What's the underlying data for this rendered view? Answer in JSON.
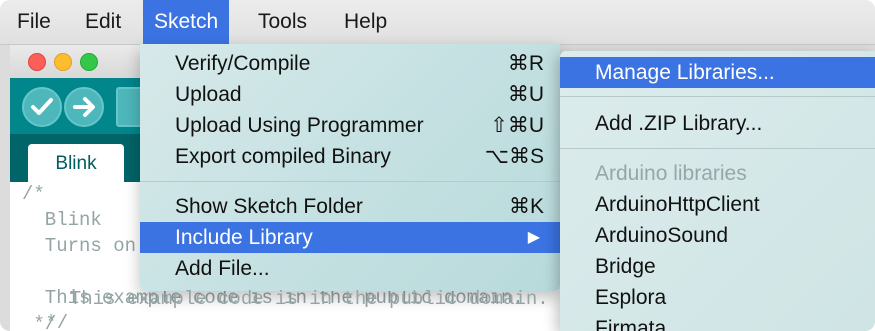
{
  "menubar": {
    "items": [
      "File",
      "Edit",
      "Sketch",
      "Tools",
      "Help"
    ],
    "active": "Sketch"
  },
  "window": {
    "tab_label": "Blink",
    "code_lines": [
      "/*",
      "  Blink",
      "  Turns on",
      "",
      "  This example code is in the public domain.",
      " */"
    ]
  },
  "sketch_menu": {
    "items": [
      {
        "label": "Verify/Compile",
        "shortcut": "⌘R"
      },
      {
        "label": "Upload",
        "shortcut": "⌘U"
      },
      {
        "label": "Upload Using Programmer",
        "shortcut": "⇧⌘U"
      },
      {
        "label": "Export compiled Binary",
        "shortcut": "⌥⌘S"
      },
      {
        "label": "Show Sketch Folder",
        "shortcut": "⌘K"
      },
      {
        "label": "Include Library",
        "shortcut": "▶"
      },
      {
        "label": "Add File...",
        "shortcut": ""
      }
    ]
  },
  "library_menu": {
    "manage": "Manage Libraries...",
    "add_zip": "Add .ZIP Library...",
    "section_header": "Arduino libraries",
    "libraries": [
      "ArduinoHttpClient",
      "ArduinoSound",
      "Bridge",
      "Esplora",
      "Firmata"
    ]
  },
  "colors": {
    "accent": "#3b73e3",
    "toolbar": "#00868b",
    "tabstrip": "#006468"
  }
}
